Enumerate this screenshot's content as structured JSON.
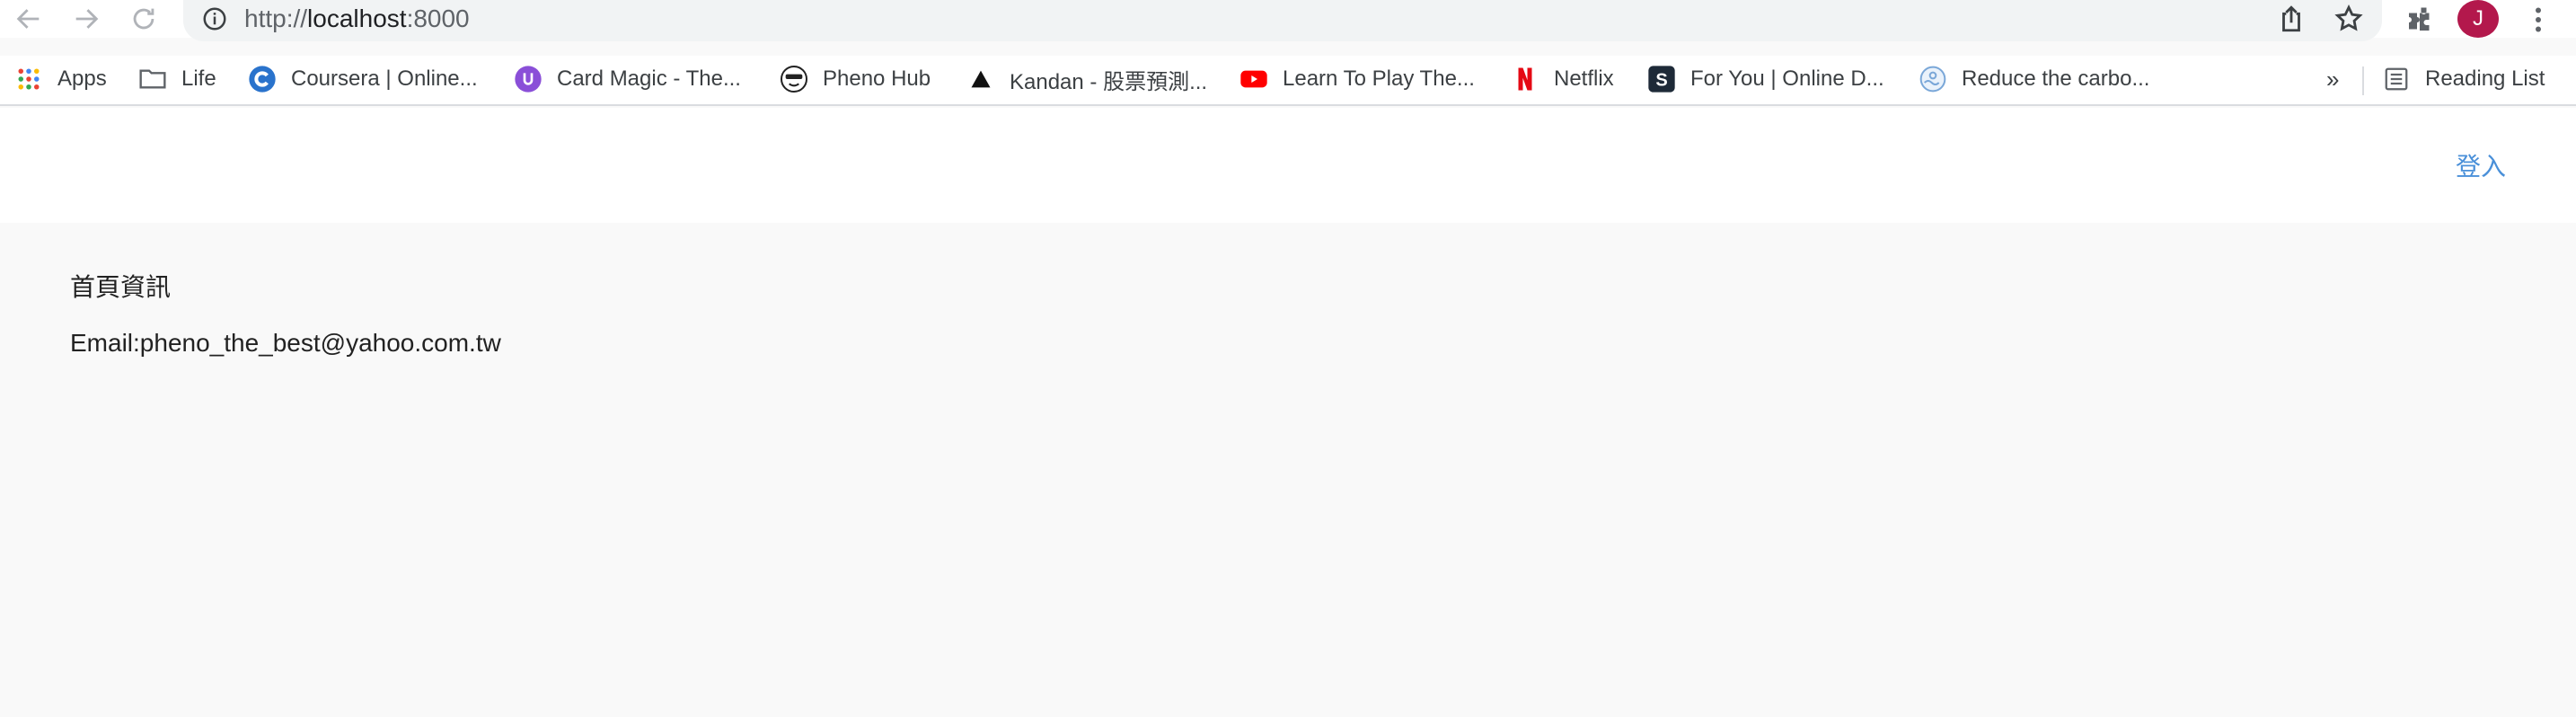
{
  "browser": {
    "url_host": "localhost",
    "url_prefix": "http://",
    "url_port": ":8000",
    "avatar_letter": "J"
  },
  "bookmarks": {
    "items": [
      {
        "label": "Apps",
        "icon": "apps-grid-icon"
      },
      {
        "label": "Life",
        "icon": "folder-icon"
      },
      {
        "label": "Coursera | Online...",
        "icon": "coursera-icon"
      },
      {
        "label": "Card Magic - The...",
        "icon": "card-magic-icon"
      },
      {
        "label": "Pheno Hub",
        "icon": "pheno-hub-icon"
      },
      {
        "label": "Kandan - 股票預測...",
        "icon": "kandan-icon"
      },
      {
        "label": "Learn To Play The...",
        "icon": "youtube-icon"
      },
      {
        "label": "Netflix",
        "icon": "netflix-icon"
      },
      {
        "label": "For You | Online D...",
        "icon": "scribd-icon"
      },
      {
        "label": "Reduce the carbo...",
        "icon": "carbon-icon"
      }
    ],
    "overflow": "»",
    "reading_list": "Reading List"
  },
  "page": {
    "login_label": "登入",
    "title": "首頁資訊",
    "email": "Email:pheno_the_best@yahoo.com.tw"
  },
  "colors": {
    "link": "#4a90d9",
    "avatar": "#b3184c",
    "content_bg": "#f9f9f9"
  }
}
